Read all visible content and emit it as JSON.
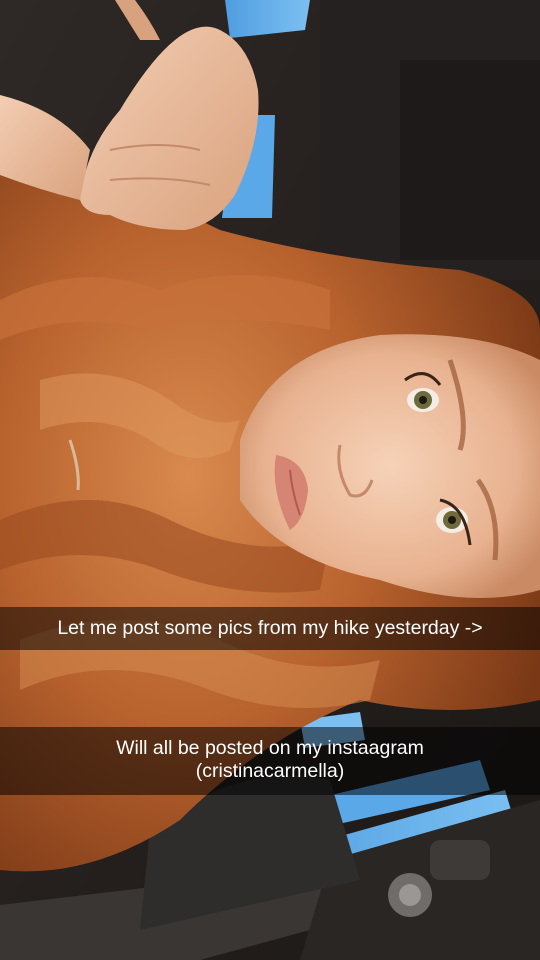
{
  "snap": {
    "caption_top": "Let me post some pics from my hike yesterday ->",
    "caption_bottom_line1": "Will all be posted on my instaagram",
    "caption_bottom_line2": "(cristinacarmella)"
  },
  "photo": {
    "subject": "selfie-photo",
    "colors": {
      "hair": "#b8622e",
      "skin": "#e8b89a",
      "car_interior": "#2a2624",
      "sky": "#5aa8e8"
    }
  }
}
